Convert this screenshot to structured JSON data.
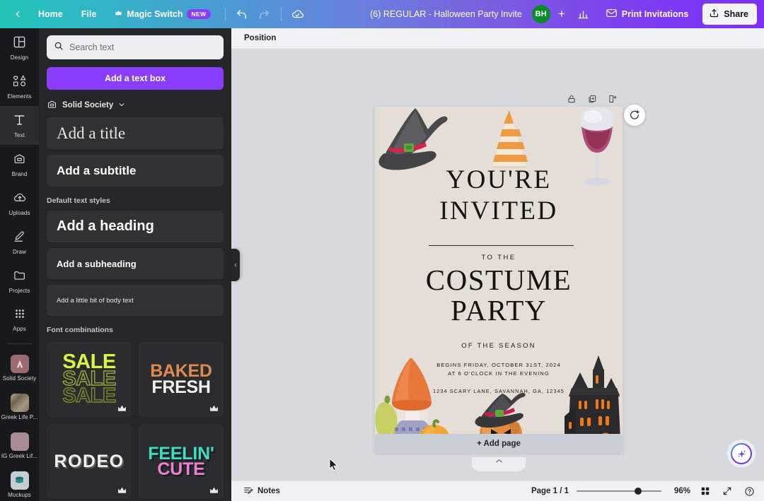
{
  "topbar": {
    "back_label": "",
    "home_label": "Home",
    "file_label": "File",
    "magic_switch_label": "Magic Switch",
    "magic_switch_badge": "NEW",
    "undo_icon": "undo-icon",
    "redo_icon": "redo-icon",
    "cloud_icon": "cloud-saved-icon",
    "doc_title": "(6) REGULAR - Halloween Party Invite",
    "avatar_initials": "BH",
    "add_collaborator_label": "+",
    "insights_icon": "insights-bar-chart-icon",
    "print_label": "Print Invitations",
    "share_label": "Share",
    "gradient_start": "#23c4b8",
    "gradient_end": "#7b2ff7",
    "badge_color": "#8b3dff"
  },
  "rail": {
    "items": [
      {
        "label": "Design",
        "icon": "design-grid-icon",
        "active": false
      },
      {
        "label": "Elements",
        "icon": "elements-shapes-icon",
        "active": false
      },
      {
        "label": "Text",
        "icon": "text-t-icon",
        "active": true
      },
      {
        "label": "Brand",
        "icon": "brand-kit-icon",
        "active": false
      },
      {
        "label": "Uploads",
        "icon": "uploads-cloud-icon",
        "active": false
      },
      {
        "label": "Draw",
        "icon": "draw-pen-icon",
        "active": false
      },
      {
        "label": "Projects",
        "icon": "projects-folder-icon",
        "active": false
      },
      {
        "label": "Apps",
        "icon": "apps-dots-icon",
        "active": false
      }
    ],
    "brand_items": [
      {
        "label": "Solid Society",
        "icon": "brand-thumb-solid-society",
        "color": "#9c6a72"
      },
      {
        "label": "Greek Life P...",
        "icon": "brand-thumb-greek-life",
        "color": "#9a8f7a"
      },
      {
        "label": "IG Greek Lif...",
        "icon": "brand-thumb-ig-greek-life",
        "color": "#a98c93"
      },
      {
        "label": "Mockups",
        "icon": "brand-thumb-mockups",
        "color": "#b9c2c7"
      }
    ]
  },
  "panel": {
    "search": {
      "placeholder": "Search text",
      "value": "",
      "icon": "search-icon"
    },
    "add_text_box_label": "Add a text box",
    "brand_kit": {
      "label": "Solid Society",
      "icon": "brand-kit-icon",
      "chevron": "chevron-down-icon"
    },
    "brand_styles": [
      {
        "label": "Add a title",
        "style": "title"
      },
      {
        "label": "Add a subtitle",
        "style": "subtitle"
      }
    ],
    "default_styles_label": "Default text styles",
    "default_styles": [
      {
        "label": "Add a heading",
        "style": "heading"
      },
      {
        "label": "Add a subheading",
        "style": "subheading"
      },
      {
        "label": "Add a little bit of body text",
        "style": "body"
      }
    ],
    "font_combinations_label": "Font combinations",
    "font_combinations": [
      {
        "lines": [
          "SALE",
          "SALE",
          "SALE"
        ],
        "name": "sale-neon",
        "pro": true
      },
      {
        "lines": [
          "BAKED",
          "FRESH"
        ],
        "name": "baked-fresh",
        "pro": true
      },
      {
        "lines": [
          "RODEO"
        ],
        "name": "rodeo",
        "pro": true
      },
      {
        "lines": [
          "FEELIN'",
          "CUTE"
        ],
        "name": "feelin-cute",
        "pro": true
      }
    ],
    "collapse_icon": "chevron-left-icon"
  },
  "workspace": {
    "context_bar": {
      "position_label": "Position"
    },
    "page_tools": [
      {
        "icon": "lock-icon"
      },
      {
        "icon": "duplicate-page-icon"
      },
      {
        "icon": "add-page-icon"
      }
    ],
    "comment_icon": "add-comment-icon",
    "add_page_label": "+ Add page",
    "scroll_nub_icon": "chevron-up-icon",
    "ai_assistant_icon": "magic-sparkle-icon"
  },
  "card": {
    "background": "#e4ded7",
    "title_line1": "YOU'RE",
    "title_line2": "INVITED",
    "to_the": "TO THE",
    "event_line1": "COSTUME",
    "event_line2": "PARTY",
    "season": "OF THE SEASON",
    "when_line1": "BEGINS FRIDAY, OCTOBER 31ST, 2024",
    "when_line2": "AT 6 O'CLOCK IN THE EVENING",
    "address": "1234 SCARY LANE, SAVANNAH, GA, 12345",
    "graphics": [
      {
        "name": "witch-hat-illustration"
      },
      {
        "name": "party-hat-illustration"
      },
      {
        "name": "wine-glass-illustration"
      },
      {
        "name": "gnome-pumpkins-illustration"
      },
      {
        "name": "jack-o-lantern-witch-hat-illustration"
      },
      {
        "name": "haunted-house-illustration"
      }
    ]
  },
  "bottombar": {
    "notes_label": "Notes",
    "notes_icon": "notes-icon",
    "page_indicator": "Page 1 / 1",
    "zoom_value": "96%",
    "grid_view_icon": "grid-view-icon",
    "fullscreen_icon": "fullscreen-icon",
    "help_icon": "help-question-icon"
  }
}
